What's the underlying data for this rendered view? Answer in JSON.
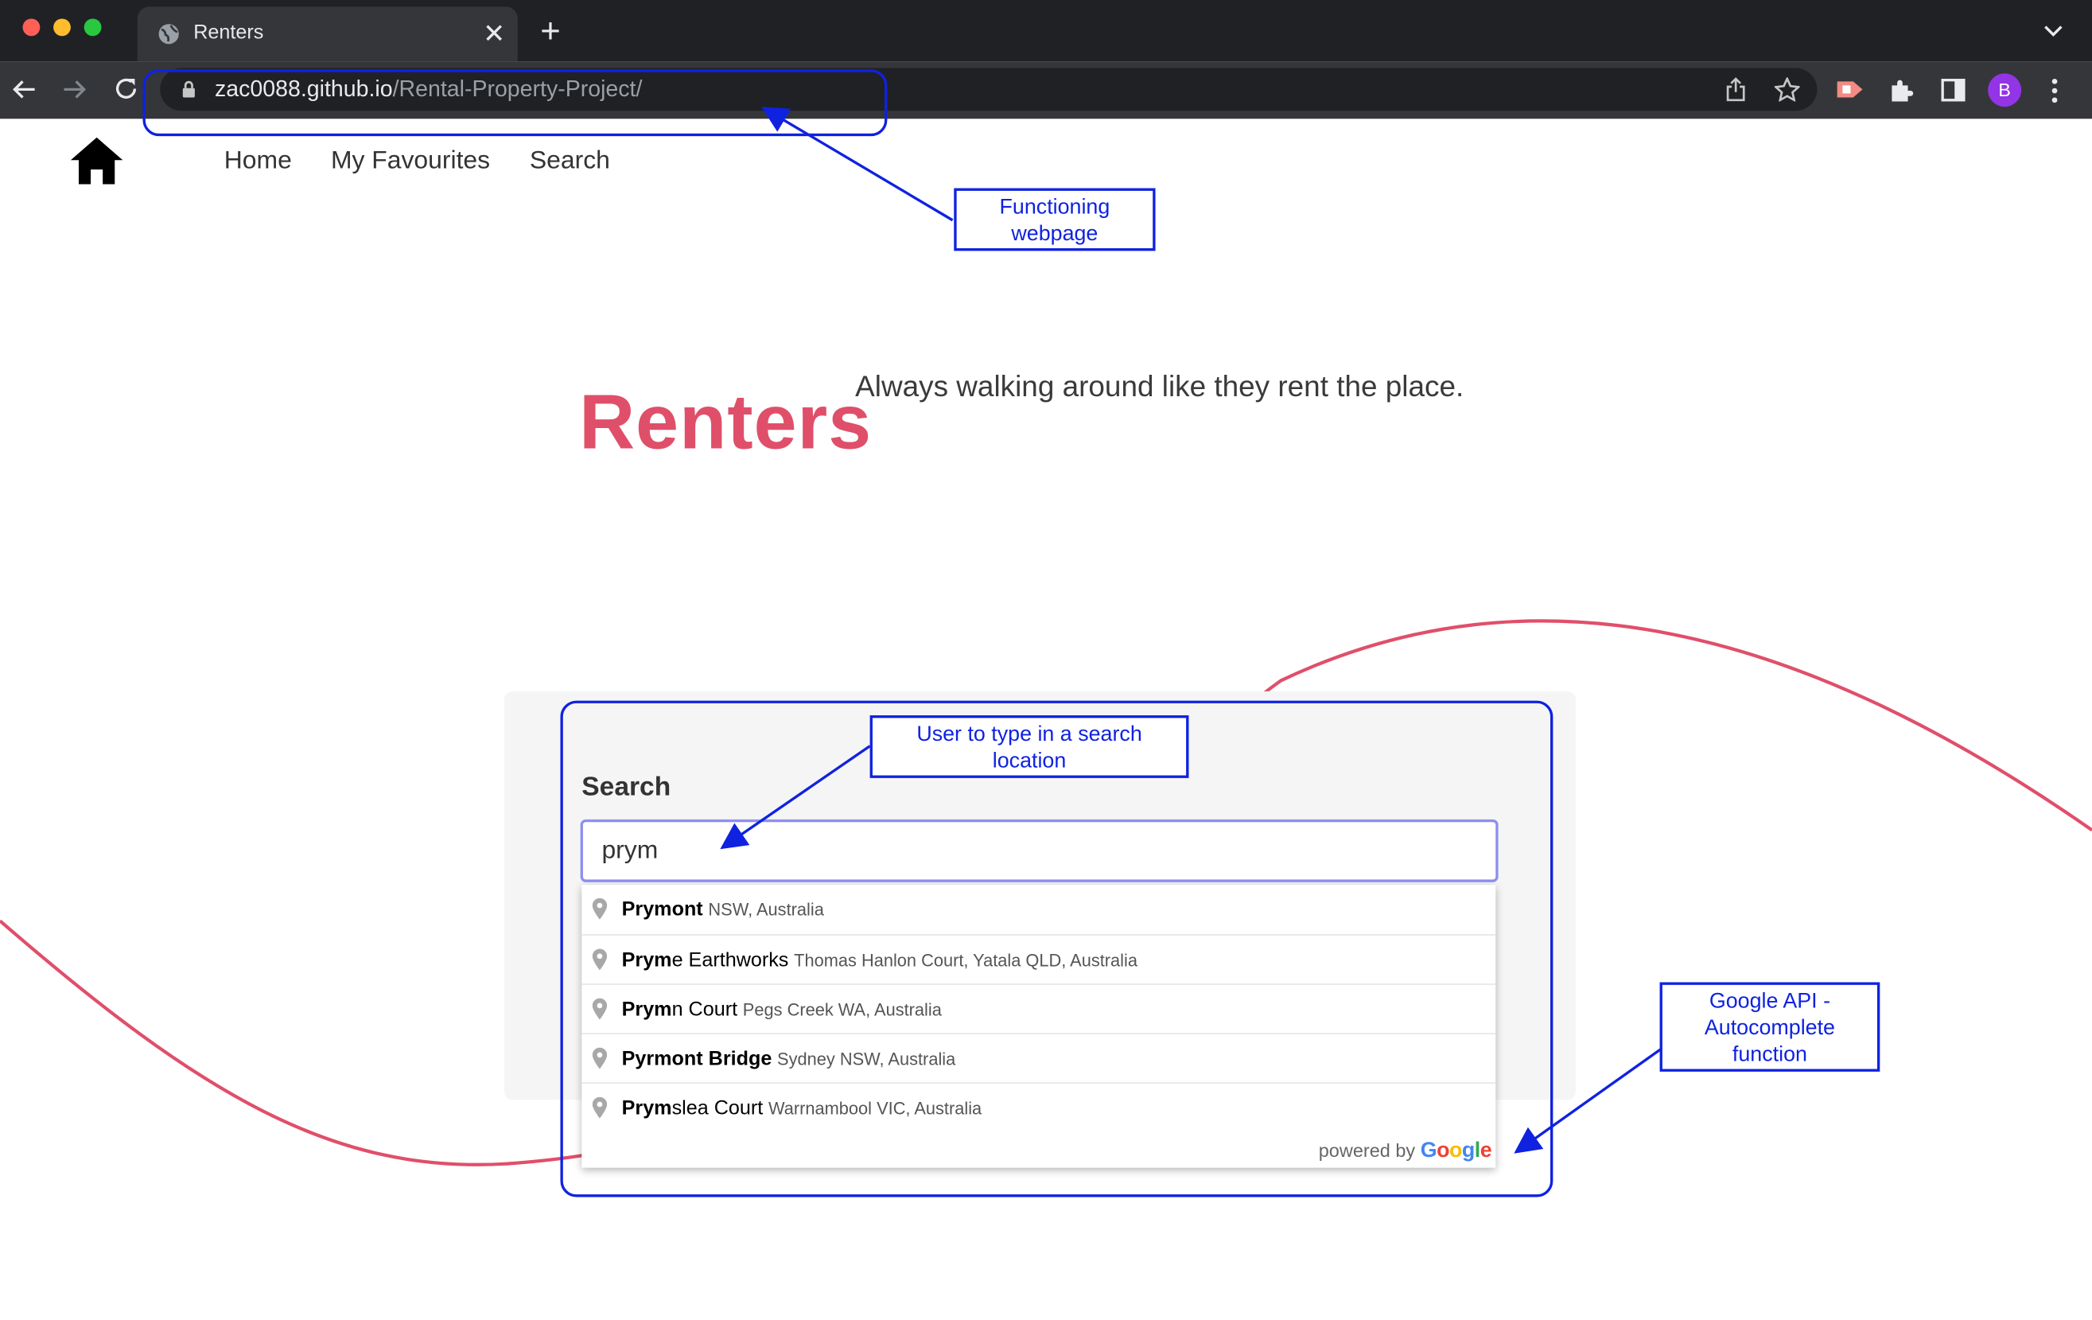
{
  "browser": {
    "tab_title": "Renters",
    "url_host": "zac0088.github.io",
    "url_path": "/Rental-Property-Project/",
    "profile_initial": "B"
  },
  "nav": {
    "home_icon": "house-icon",
    "links": [
      "Home",
      "My Favourites",
      "Search"
    ]
  },
  "hero": {
    "brand": "Renters",
    "tagline": "Always walking around like they rent the place."
  },
  "search": {
    "label": "Search",
    "value": "prym"
  },
  "suggestions": [
    {
      "match": "Prym",
      "rest": "ont",
      "secondary": "NSW, Australia"
    },
    {
      "match": "Prym",
      "rest": "e Earthworks",
      "secondary": "Thomas Hanlon Court, Yatala QLD, Australia"
    },
    {
      "match": "Prym",
      "rest": "n Court",
      "secondary": "Pegs Creek WA, Australia"
    },
    {
      "match": "Pyrmont Bridge",
      "rest": "",
      "secondary": "Sydney NSW, Australia"
    },
    {
      "match": "Prym",
      "rest": "slea Court",
      "secondary": "Warrnambool VIC, Australia"
    }
  ],
  "powered_by": "powered by",
  "powered_brand": "Google",
  "annotations": {
    "webpage": [
      "Functioning",
      "webpage"
    ],
    "search_input": [
      "User to type in a search",
      "location"
    ],
    "autocomplete": [
      "Google API -",
      "Autocomplete",
      "function"
    ]
  },
  "colors": {
    "brand": "#e04f6a",
    "wave": "#e04f6a",
    "annotation": "#0f22e0"
  }
}
